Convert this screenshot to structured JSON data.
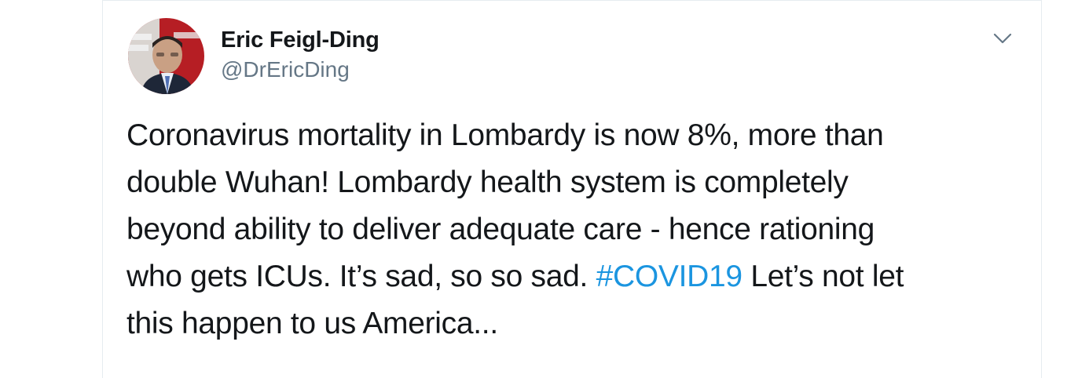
{
  "tweet": {
    "author": {
      "display_name": "Eric Feigl-Ding",
      "handle": "@DrEricDing"
    },
    "text": {
      "line1": "Coronavirus mortality in Lombardy is now 8%, more than",
      "line2": "double Wuhan! Lombardy health system is completely",
      "line3": "beyond ability to deliver adequate care - hence rationing",
      "line4_before": "who gets ICUs. It’s sad, so so sad. ",
      "line4_hashtag": "#COVID19",
      "line4_after": " Let’s not let",
      "line5": "this happen to us America..."
    },
    "menu_icon": "chevron-down-icon"
  },
  "colors": {
    "text": "#14171a",
    "secondary": "#657786",
    "hashtag": "#1b95e0",
    "border": "#e6ecf0"
  }
}
